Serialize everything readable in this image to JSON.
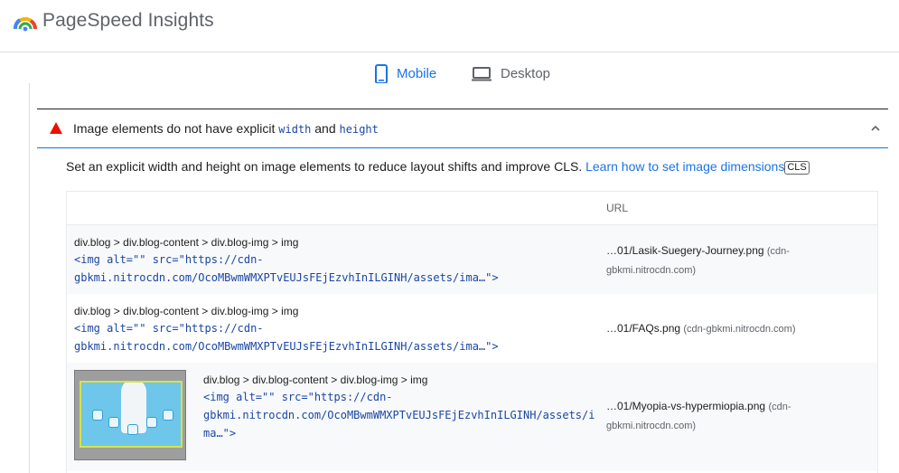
{
  "app": {
    "title": "PageSpeed Insights"
  },
  "tabs": [
    {
      "label": "Mobile",
      "active": true
    },
    {
      "label": "Desktop",
      "active": false
    }
  ],
  "audit": {
    "title_prefix": "Image elements do not have explicit ",
    "title_code1": "width",
    "title_mid": " and ",
    "title_code2": "height",
    "status": "fail",
    "description": "Set an explicit width and height on image elements to reduce layout shifts and improve CLS. ",
    "link_text": "Learn how to set image dimensions",
    "badge": "CLS"
  },
  "table": {
    "headers": {
      "url": "URL"
    },
    "rows": [
      {
        "selector": "div.blog > div.blog-content > div.blog-img > img",
        "snippet_line1": "<img alt=\"\" src=\"https://cdn-",
        "snippet_line2": "gbkmi.nitrocdn.com/OcoMBwmWMXPTvEUJsFEjEzvhInILGINH/assets/ima…\">",
        "url_file": "…01/Lasik-Suegery-Journey.png",
        "url_origin_1": "(cdn-",
        "url_origin_2": "gbkmi.nitrocdn.com)"
      },
      {
        "selector": "div.blog > div.blog-content > div.blog-img > img",
        "snippet_line1": "<img alt=\"\" src=\"https://cdn-",
        "snippet_line2": "gbkmi.nitrocdn.com/OcoMBwmWMXPTvEUJsFEjEzvhInILGINH/assets/ima…\">",
        "url_file": "…01/FAQs.png",
        "url_origin_1": "(cdn-gbkmi.nitrocdn.com)"
      },
      {
        "selector": "div.blog > div.blog-content > div.blog-img > img",
        "snippet_line1": "<img alt=\"\" src=\"https://cdn-",
        "snippet_line2": "gbkmi.nitrocdn.com/OcoMBwmWMXPTvEUJsFEjEzvhInILGINH/assets/i",
        "snippet_line3": "ma…\">",
        "url_file": "…01/Myopia-vs-hypermiopia.png",
        "url_origin_1": "(cdn-",
        "url_origin_2": "gbkmi.nitrocdn.com)"
      }
    ]
  },
  "colors": {
    "accent": "#1a73e8",
    "fail": "#eb0f00",
    "code": "#1a47a5"
  }
}
